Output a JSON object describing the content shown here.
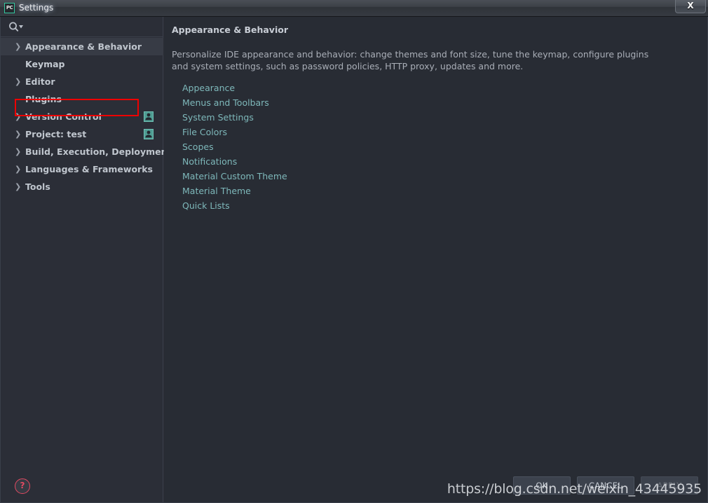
{
  "window": {
    "title": "Settings",
    "app_icon": "pycharm-pc-icon",
    "close_label": "X",
    "accent_green": "#34c8a0"
  },
  "search": {
    "value": "",
    "placeholder": "",
    "icon": "search-icon"
  },
  "sidebar": {
    "items": [
      {
        "label": "Appearance & Behavior",
        "expandable": true,
        "selected": true,
        "badge": false,
        "indent": 0
      },
      {
        "label": "Keymap",
        "expandable": false,
        "selected": false,
        "badge": false,
        "indent": 1
      },
      {
        "label": "Editor",
        "expandable": true,
        "selected": false,
        "badge": false,
        "indent": 0
      },
      {
        "label": "Plugins",
        "expandable": false,
        "selected": false,
        "badge": false,
        "indent": 1
      },
      {
        "label": "Version Control",
        "expandable": true,
        "selected": false,
        "badge": true,
        "indent": 0
      },
      {
        "label": "Project: test",
        "expandable": true,
        "selected": false,
        "badge": true,
        "indent": 0
      },
      {
        "label": "Build, Execution, Deployment",
        "expandable": true,
        "selected": false,
        "badge": false,
        "indent": 0
      },
      {
        "label": "Languages & Frameworks",
        "expandable": true,
        "selected": false,
        "badge": false,
        "indent": 0
      },
      {
        "label": "Tools",
        "expandable": true,
        "selected": false,
        "badge": false,
        "indent": 0
      }
    ],
    "help_label": "?"
  },
  "annotation": {
    "target": "Plugins",
    "color": "#ee0000"
  },
  "main": {
    "title": "Appearance & Behavior",
    "description": "Personalize IDE appearance and behavior: change themes and font size, tune the keymap, configure plugins and system settings, such as password policies, HTTP proxy, updates and more.",
    "links": [
      "Appearance",
      "Menus and Toolbars",
      "System Settings",
      "File Colors",
      "Scopes",
      "Notifications",
      "Material Custom Theme",
      "Material Theme",
      "Quick Lists"
    ]
  },
  "buttons": {
    "ok": "OK",
    "cancel": "CANCEL",
    "apply": "APPLY"
  },
  "watermark": {
    "text": "https://blog.csdn.net/weixin_43445935"
  }
}
